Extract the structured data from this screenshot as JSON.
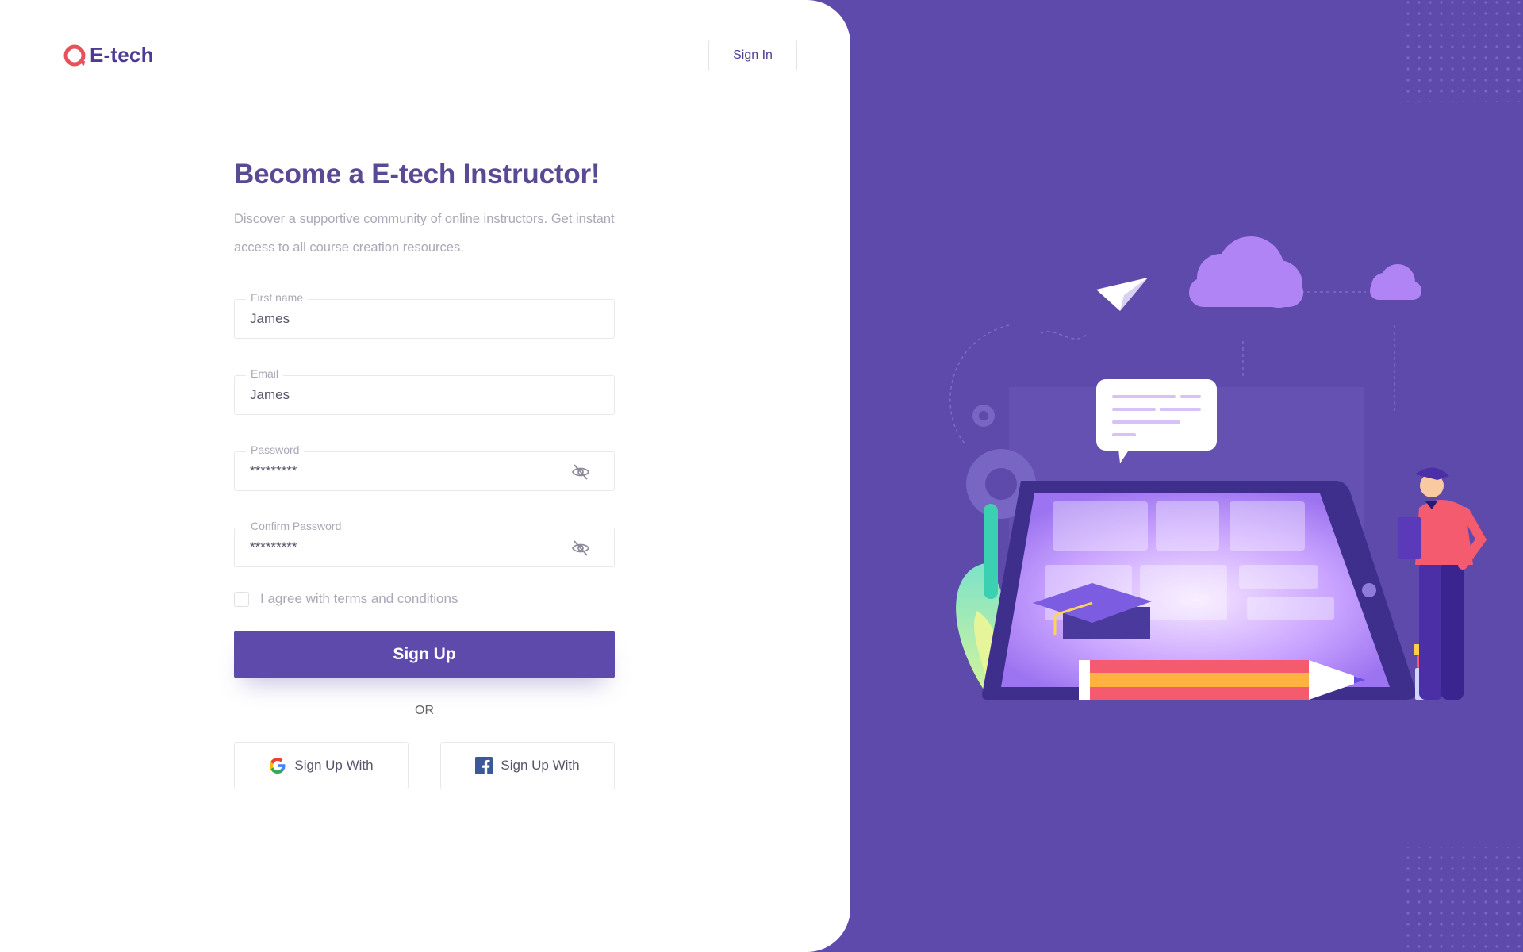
{
  "brand": {
    "name": "E-tech",
    "accent": "#5d4aab",
    "logo_color": "#e8505b"
  },
  "header": {
    "signin_label": "Sign In"
  },
  "form": {
    "title": "Become a E-tech Instructor!",
    "subtitle": "Discover a supportive community of online instructors. Get instant access to all course creation resources.",
    "fields": {
      "first_name": {
        "label": "First name",
        "value": "James"
      },
      "email": {
        "label": "Email",
        "value": "James"
      },
      "password": {
        "label": "Password",
        "value": "*********"
      },
      "confirm_password": {
        "label": "Confirm Password",
        "value": "*********"
      }
    },
    "agree_label": "I agree with terms and conditions",
    "agree_checked": false,
    "submit_label": "Sign Up",
    "or_label": "OR",
    "google_label": "Sign Up With",
    "facebook_label": "Sign Up With"
  },
  "icons": [
    "logo-icon",
    "eye-off-icon",
    "google-icon",
    "facebook-icon"
  ]
}
